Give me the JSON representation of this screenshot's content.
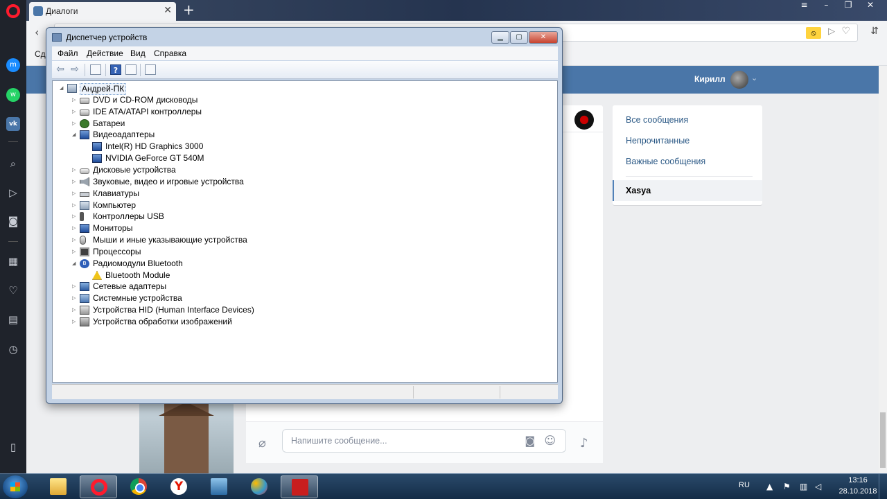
{
  "browser": {
    "tab_title": "Диалоги",
    "tab_close": "✕",
    "tab_new": "+",
    "address": "",
    "bookmarks_text": "Сде"
  },
  "opera_sidebar": {
    "icons": [
      "opera-logo-icon",
      "messenger-icon",
      "whatsapp-icon",
      "vk-icon",
      "search-icon",
      "send-icon",
      "camera-icon",
      "apps-icon",
      "heart-icon",
      "news-icon",
      "history-icon",
      "sidebar-toggle-icon"
    ]
  },
  "vk": {
    "user_name": "Кирилл",
    "menu": {
      "all": "Все сообщения",
      "unread": "Непрочитанные",
      "important": "Важные сообщения",
      "active": "Xasya"
    },
    "input_placeholder": "Напишите сообщение..."
  },
  "device_manager": {
    "title": "Диспетчер устройств",
    "menus": [
      "Файл",
      "Действие",
      "Вид",
      "Справка"
    ],
    "root": "Андрей-ПК",
    "tree": [
      {
        "label": "DVD и CD-ROM дисководы",
        "icon": "dvd-drive-icon",
        "level": 1,
        "expanded": false
      },
      {
        "label": "IDE ATA/ATAPI контроллеры",
        "icon": "ide-controller-icon",
        "level": 1,
        "expanded": false
      },
      {
        "label": "Батареи",
        "icon": "battery-icon",
        "level": 1,
        "expanded": false
      },
      {
        "label": "Видеоадаптеры",
        "icon": "display-adapter-icon",
        "level": 1,
        "expanded": true
      },
      {
        "label": "Intel(R) HD Graphics 3000",
        "icon": "display-adapter-icon",
        "level": 2
      },
      {
        "label": "NVIDIA GeForce GT 540M",
        "icon": "display-adapter-icon",
        "level": 2
      },
      {
        "label": "Дисковые устройства",
        "icon": "disk-drive-icon",
        "level": 1,
        "expanded": false
      },
      {
        "label": "Звуковые, видео и игровые устройства",
        "icon": "speaker-icon",
        "level": 1,
        "expanded": false
      },
      {
        "label": "Клавиатуры",
        "icon": "keyboard-icon",
        "level": 1,
        "expanded": false
      },
      {
        "label": "Компьютер",
        "icon": "computer-icon",
        "level": 1,
        "expanded": false
      },
      {
        "label": "Контроллеры USB",
        "icon": "usb-icon",
        "level": 1,
        "expanded": false
      },
      {
        "label": "Мониторы",
        "icon": "monitor-icon",
        "level": 1,
        "expanded": false
      },
      {
        "label": "Мыши и иные указывающие устройства",
        "icon": "mouse-icon",
        "level": 1,
        "expanded": false
      },
      {
        "label": "Процессоры",
        "icon": "cpu-icon",
        "level": 1,
        "expanded": false
      },
      {
        "label": "Радиомодули Bluetooth",
        "icon": "bluetooth-icon",
        "level": 1,
        "expanded": true
      },
      {
        "label": "Bluetooth Module",
        "icon": "warning-icon",
        "level": 2
      },
      {
        "label": "Сетевые адаптеры",
        "icon": "network-adapter-icon",
        "level": 1,
        "expanded": false
      },
      {
        "label": "Системные устройства",
        "icon": "system-device-icon",
        "level": 1,
        "expanded": false
      },
      {
        "label": "Устройства HID (Human Interface Devices)",
        "icon": "hid-icon",
        "level": 1,
        "expanded": false
      },
      {
        "label": "Устройства обработки изображений",
        "icon": "imaging-device-icon",
        "level": 1,
        "expanded": false
      }
    ]
  },
  "taskbar": {
    "apps": [
      "explorer",
      "opera",
      "chrome",
      "yandex",
      "remote-desktop",
      "paint",
      "device-manager"
    ],
    "language": "RU",
    "time": "13:16",
    "date": "28.10.2018"
  }
}
